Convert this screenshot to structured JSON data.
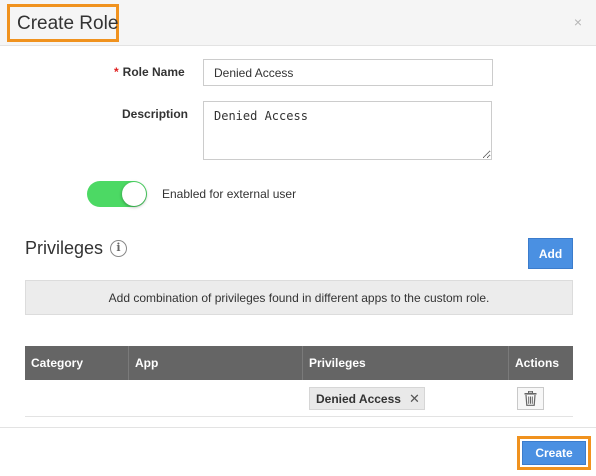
{
  "dialog": {
    "title": "Create Role",
    "close_icon": "close-icon",
    "close_glyph": "×"
  },
  "form": {
    "role_name_label": "Role Name",
    "required_marker": "*",
    "role_name_value": "Denied Access",
    "description_label": "Description",
    "description_value": "Denied Access",
    "external_toggle_label": "Enabled for external user",
    "external_toggle_on": true
  },
  "privileges": {
    "title": "Privileges",
    "info_glyph": "i",
    "add_label": "Add",
    "banner_text": "Add combination of privileges found in different apps to the custom role.",
    "columns": [
      "Category",
      "App",
      "Privileges",
      "Actions"
    ],
    "rows": [
      {
        "category": "",
        "app": "",
        "privilege": "Denied Access",
        "remove_glyph": "✕",
        "action_icon": "trash-icon"
      }
    ]
  },
  "footer": {
    "create_label": "Create"
  },
  "colors": {
    "accent": "#4a90e2",
    "highlight": "#f0921e",
    "toggle_on": "#4cd964",
    "table_header": "#656565",
    "required": "#e02020"
  }
}
